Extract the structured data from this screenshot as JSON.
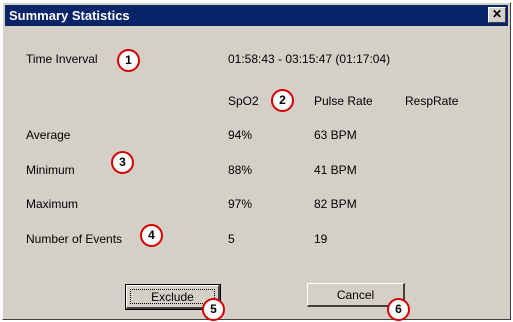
{
  "window": {
    "title": "Summary Statistics",
    "close_glyph": "✕"
  },
  "time_interval": {
    "label": "Time Inverval",
    "value": "01:58:43 - 03:15:47 (01:17:04)"
  },
  "columns": {
    "spo2": "SpO2",
    "pulse": "Pulse Rate",
    "resp": "RespRate"
  },
  "rows": [
    {
      "label": "Average",
      "spo2": "94%",
      "pulse": "63 BPM"
    },
    {
      "label": "Minimum",
      "spo2": "88%",
      "pulse": "41 BPM"
    },
    {
      "label": "Maximum",
      "spo2": "97%",
      "pulse": "82 BPM"
    },
    {
      "label": "Number of Events",
      "spo2": "5",
      "pulse": "19"
    }
  ],
  "badges": [
    "1",
    "2",
    "3",
    "4",
    "5",
    "6"
  ],
  "buttons": {
    "exclude": "Exclude",
    "cancel": "Cancel"
  }
}
